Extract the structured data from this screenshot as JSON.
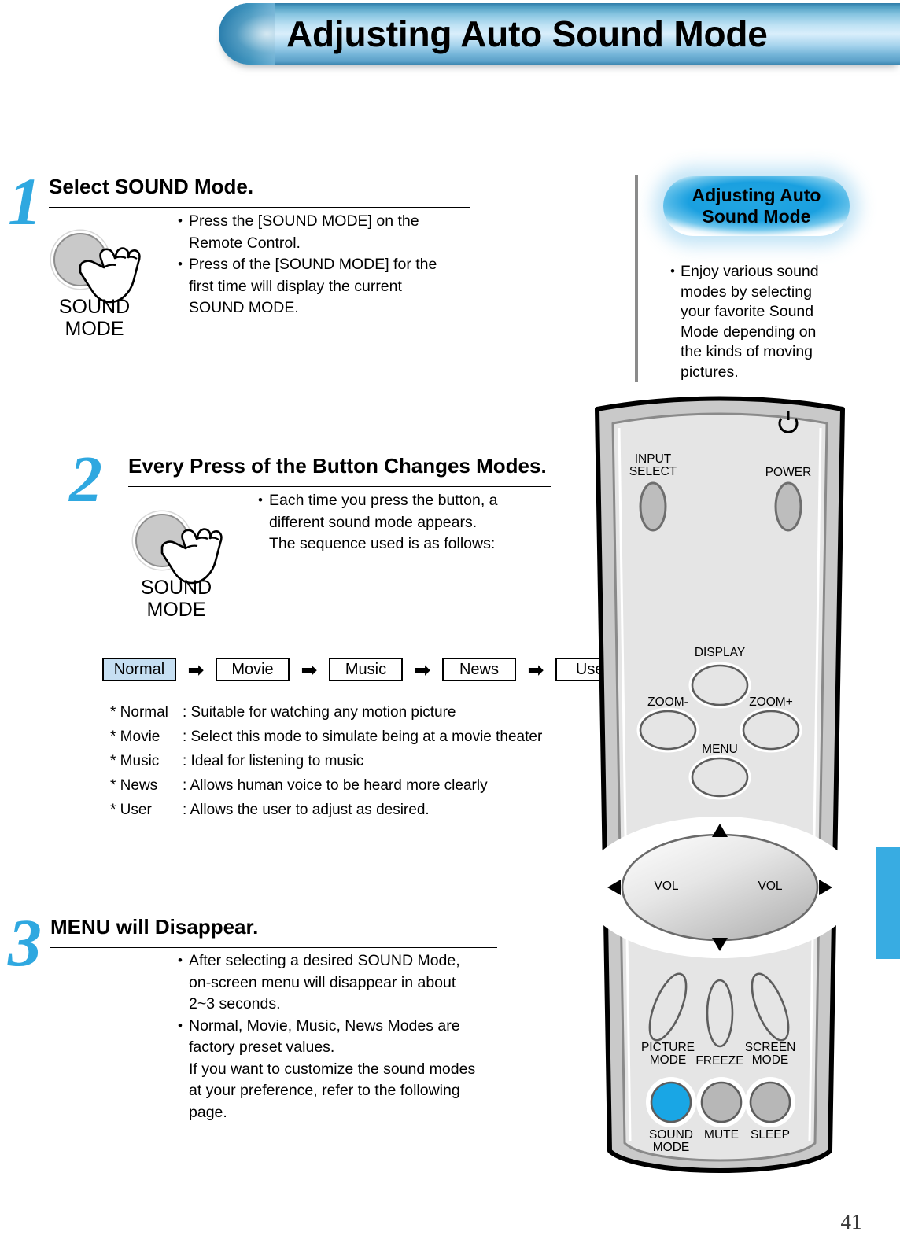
{
  "header": {
    "title": "Adjusting Auto Sound Mode"
  },
  "page": {
    "number": "41"
  },
  "side_panel": {
    "pill_title_line1": "Adjusting Auto",
    "pill_title_line2": "Sound Mode",
    "body": "Enjoy various sound modes by selecting your favorite Sound Mode depending on the kinds of moving pictures."
  },
  "steps": [
    {
      "number": "1",
      "title": "Select SOUND Mode.",
      "button_label_line1": "SOUND",
      "button_label_line2": "MODE",
      "bullets": [
        [
          "Press the [SOUND MODE] on the",
          "Remote Control."
        ],
        [
          "Press of the [SOUND MODE] for the",
          "first time will display the current",
          "SOUND MODE."
        ]
      ]
    },
    {
      "number": "2",
      "title": "Every Press of the Button Changes Modes.",
      "button_label_line1": "SOUND",
      "button_label_line2": "MODE",
      "bullets": [
        [
          "Each time you press the button, a",
          "different sound mode appears.",
          "The sequence used is as follows:"
        ]
      ]
    },
    {
      "number": "3",
      "title": "MENU will Disappear.",
      "bullets": [
        [
          "After selecting a desired SOUND Mode,",
          "on-screen menu will disappear in about",
          "2~3 seconds."
        ],
        [
          "Normal, Movie, Music, News Modes are",
          "factory preset values.",
          "If you want to customize the sound modes",
          "at your preference, refer to the following",
          "page."
        ]
      ]
    }
  ],
  "mode_chain": {
    "arrow": "➡",
    "items": [
      {
        "label": "Normal",
        "selected": true
      },
      {
        "label": "Movie",
        "selected": false
      },
      {
        "label": "Music",
        "selected": false
      },
      {
        "label": "News",
        "selected": false
      },
      {
        "label": "User",
        "selected": false
      }
    ]
  },
  "mode_descriptions": [
    {
      "key": "* Normal",
      "value": ": Suitable for watching any motion picture"
    },
    {
      "key": "* Movie",
      "value": ": Select this mode to simulate being at a movie theater"
    },
    {
      "key": "* Music",
      "value": ": Ideal for listening to music"
    },
    {
      "key": "* News",
      "value": ": Allows human voice to be heard more clearly"
    },
    {
      "key": "* User",
      "value": ": Allows the user to adjust as desired."
    }
  ],
  "remote": {
    "buttons": {
      "input_select_l1": "INPUT",
      "input_select_l2": "SELECT",
      "power": "POWER",
      "display": "DISPLAY",
      "zoom_minus": "ZOOM-",
      "zoom_plus": "ZOOM+",
      "menu": "MENU",
      "vol_left": "VOL",
      "vol_right": "VOL",
      "picture_mode_l1": "PICTURE",
      "picture_mode_l2": "MODE",
      "freeze": "FREEZE",
      "screen_mode_l1": "SCREEN",
      "screen_mode_l2": "MODE",
      "sound_mode_l1": "SOUND",
      "sound_mode_l2": "MODE",
      "mute": "MUTE",
      "sleep": "SLEEP"
    }
  },
  "colors": {
    "accent_blue": "#2fa8e0",
    "tab_blue": "#38ace2",
    "selected_mode_fill": "#c6dff2",
    "highlight_button": "#19a6e5"
  }
}
